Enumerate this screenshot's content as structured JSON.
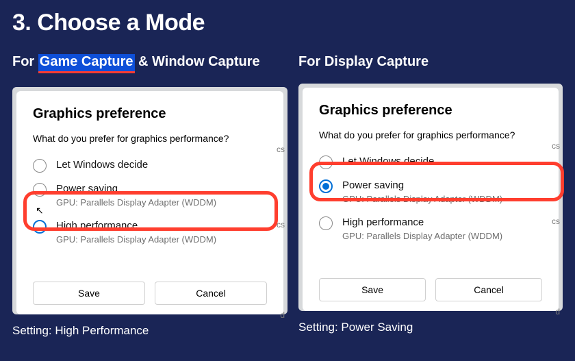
{
  "heading": "3. Choose a Mode",
  "left": {
    "subheading_prefix": "For ",
    "subheading_hl": "Game Capture",
    "subheading_suffix": " & Window Capture",
    "card": {
      "title": "Graphics preference",
      "question": "What do you prefer for graphics performance?",
      "options": [
        {
          "label": "Let Windows decide",
          "sub": ""
        },
        {
          "label": "Power saving",
          "sub": "GPU: Parallels Display Adapter (WDDM)"
        },
        {
          "label": "High performance",
          "sub": "GPU: Parallels Display Adapter (WDDM)"
        }
      ],
      "save": "Save",
      "cancel": "Cancel"
    },
    "edge": "cs",
    "edge2": "cs",
    "edge3": "d",
    "caption": "Setting: High Performance"
  },
  "right": {
    "subheading": "For Display Capture",
    "card": {
      "title": "Graphics preference",
      "question": "What do you prefer for graphics performance?",
      "options": [
        {
          "label": "Let Windows decide",
          "sub": ""
        },
        {
          "label": "Power saving",
          "sub": "GPU: Parallels Display Adapter (WDDM)"
        },
        {
          "label": "High performance",
          "sub": "GPU: Parallels Display Adapter (WDDM)"
        }
      ],
      "save": "Save",
      "cancel": "Cancel"
    },
    "edge": "cs",
    "edge2": "cs",
    "edge3": "d",
    "caption": "Setting: Power Saving"
  }
}
